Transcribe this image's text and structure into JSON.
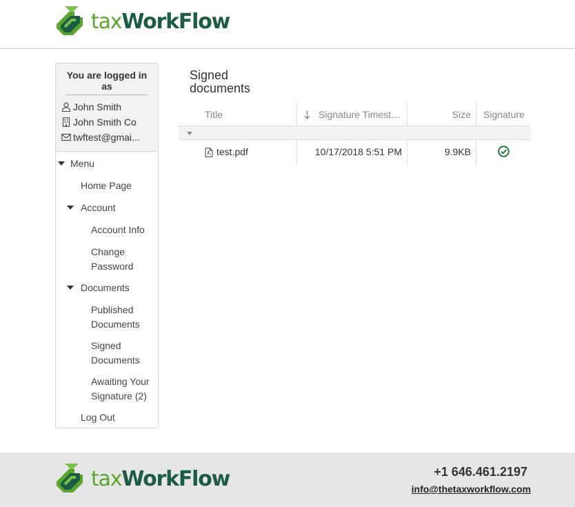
{
  "brand": {
    "tax": "tax",
    "workflow": "WorkFlow",
    "green": "#5aa52e",
    "dark_green": "#1c5d43"
  },
  "user": {
    "logged_in_label": "You are logged in as",
    "name": "John Smith",
    "company": "John Smith Co",
    "email": "twftest@gmai..."
  },
  "menu": {
    "root": "Menu",
    "home": "Home Page",
    "account": "Account",
    "account_info": "Account Info",
    "change_password_1": "Change",
    "change_password_2": "Password",
    "documents": "Documents",
    "published_1": "Published",
    "published_2": "Documents",
    "signed_1": "Signed",
    "signed_2": "Documents",
    "awaiting_1": "Awaiting Your",
    "awaiting_2": "Signature (2)",
    "logout": "Log Out"
  },
  "page": {
    "title_line1": "Signed",
    "title_line2": "documents"
  },
  "grid": {
    "columns": [
      "Title",
      "Signature Timesta...",
      "Size",
      "Signature"
    ],
    "sort_icon": "sort-down-arrow-icon",
    "rows": [
      {
        "title": "test.pdf",
        "timestamp": "10/17/2018 5:51 PM",
        "size": "9.9KB",
        "signature": "signed-check-icon"
      }
    ]
  },
  "footer": {
    "phone": "+1 646.461.2197",
    "email": "info@thetaxworkflow.com"
  }
}
